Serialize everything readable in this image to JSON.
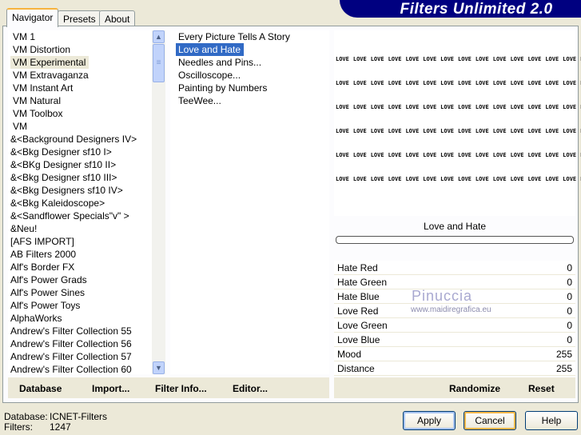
{
  "title": "Filters Unlimited 2.0",
  "tabs": [
    "Navigator",
    "Presets",
    "About"
  ],
  "categories": [
    "VM 1",
    "VM Distortion",
    "VM Experimental",
    "VM Extravaganza",
    "VM Instant Art",
    "VM Natural",
    "VM Toolbox",
    "VM",
    "&<Background Designers IV>",
    "&<Bkg Designer sf10 I>",
    "&<BKg Designer sf10 II>",
    "&<Bkg Designer sf10 III>",
    "&<Bkg Designers sf10 IV>",
    "&<Bkg Kaleidoscope>",
    "&<Sandflower Specials\"v\" >",
    "&Neu!",
    "[AFS IMPORT]",
    "AB Filters 2000",
    "Alf's Border FX",
    "Alf's Power Grads",
    "Alf's Power Sines",
    "Alf's Power Toys",
    "AlphaWorks",
    "Andrew's Filter Collection 55",
    "Andrew's Filter Collection 56",
    "Andrew's Filter Collection 57",
    "Andrew's Filter Collection 60"
  ],
  "filters": [
    "Every Picture Tells A Story",
    "Love and Hate",
    "Needles and Pins...",
    "Oscilloscope...",
    "Painting by Numbers",
    "TeeWee..."
  ],
  "preview_word": "LOVE",
  "filter_name": "Love and Hate",
  "params": [
    {
      "label": "Hate Red",
      "value": "0"
    },
    {
      "label": "Hate Green",
      "value": "0"
    },
    {
      "label": "Hate Blue",
      "value": "0"
    },
    {
      "label": "Love Red",
      "value": "0"
    },
    {
      "label": "Love Green",
      "value": "0"
    },
    {
      "label": "Love Blue",
      "value": "0"
    },
    {
      "label": "Mood",
      "value": "255"
    },
    {
      "label": "Distance",
      "value": "255"
    }
  ],
  "watermark": {
    "name": "Pinuccia",
    "url": "www.maidiregrafica.eu"
  },
  "links": {
    "database": "Database",
    "import": "Import...",
    "filter_info": "Filter Info...",
    "editor": "Editor...",
    "randomize": "Randomize",
    "reset": "Reset"
  },
  "status": {
    "database_label": "Database:",
    "database_value": "ICNET-Filters",
    "filters_label": "Filters:",
    "filters_value": "1247"
  },
  "buttons": {
    "apply": "Apply",
    "cancel": "Cancel",
    "help": "Help"
  }
}
